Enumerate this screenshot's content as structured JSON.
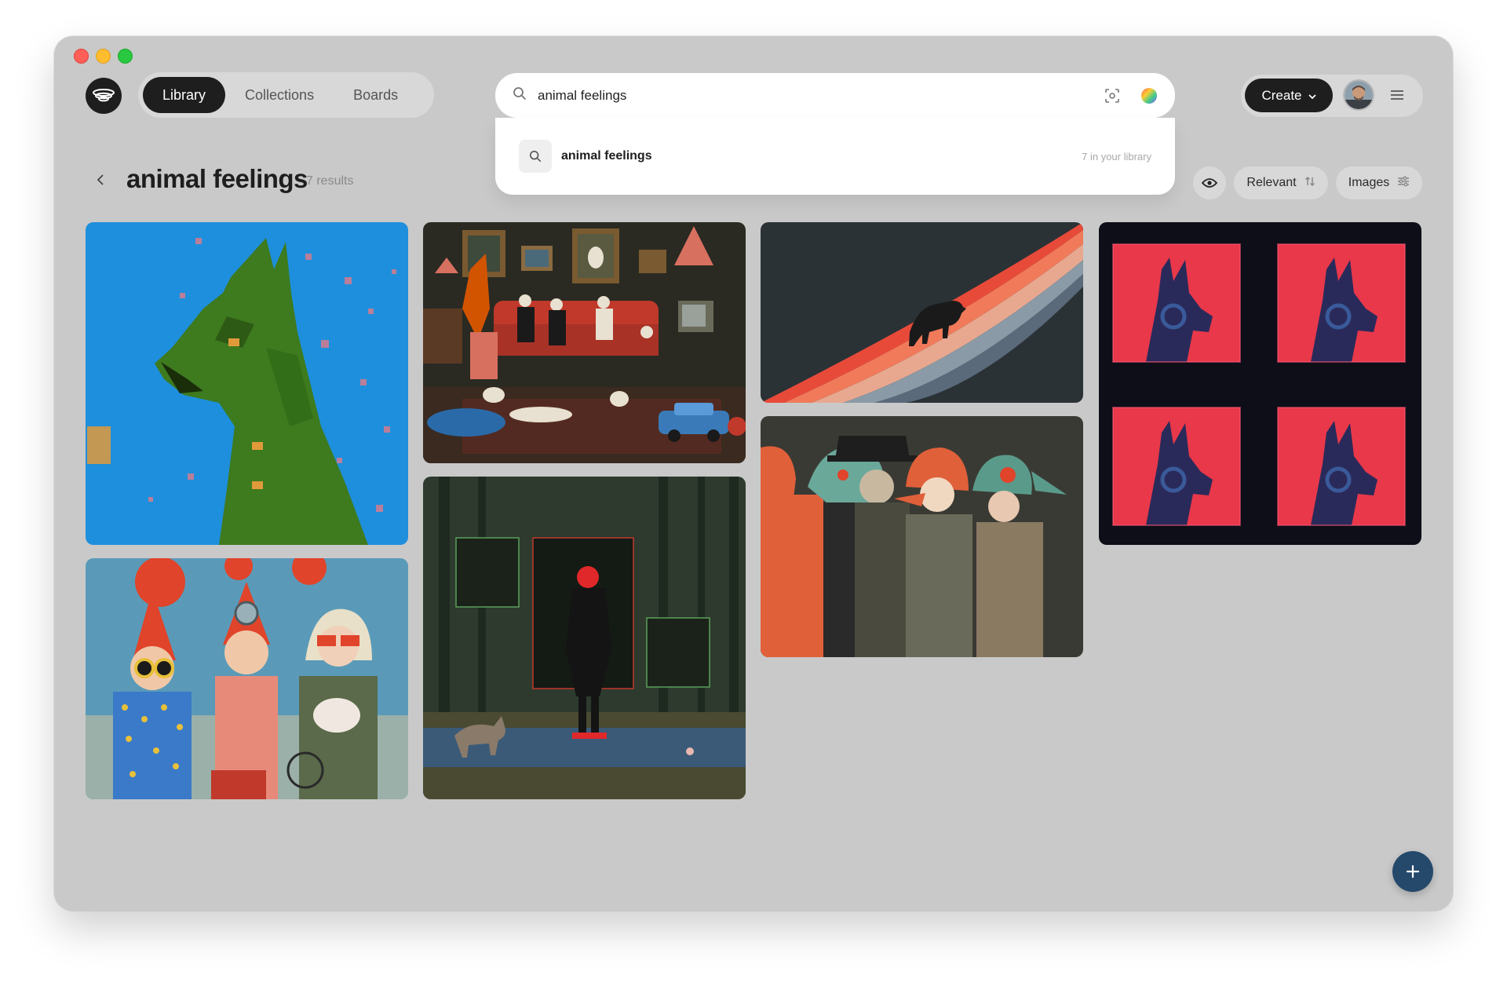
{
  "nav": {
    "items": [
      {
        "label": "Library",
        "active": true
      },
      {
        "label": "Collections",
        "active": false
      },
      {
        "label": "Boards",
        "active": false
      }
    ]
  },
  "search": {
    "value": "animal feelings",
    "suggestion": {
      "label": "animal feelings",
      "hint": "7 in your library"
    }
  },
  "header": {
    "create_label": "Create"
  },
  "page": {
    "title": "animal feelings",
    "results": "7 results",
    "sort_label": "Relevant",
    "filter_label": "Images"
  },
  "images": [
    {
      "subject": "green dog on blue"
    },
    {
      "subject": "living room animals"
    },
    {
      "subject": "bear on rainbow"
    },
    {
      "subject": "red dog grid"
    },
    {
      "subject": "children with balloons"
    },
    {
      "subject": "figure in forest"
    },
    {
      "subject": "animal-masked figures"
    }
  ],
  "colors": {
    "background": "#c9c9c9",
    "dark": "#1e1e1e",
    "fab": "#25496b"
  }
}
